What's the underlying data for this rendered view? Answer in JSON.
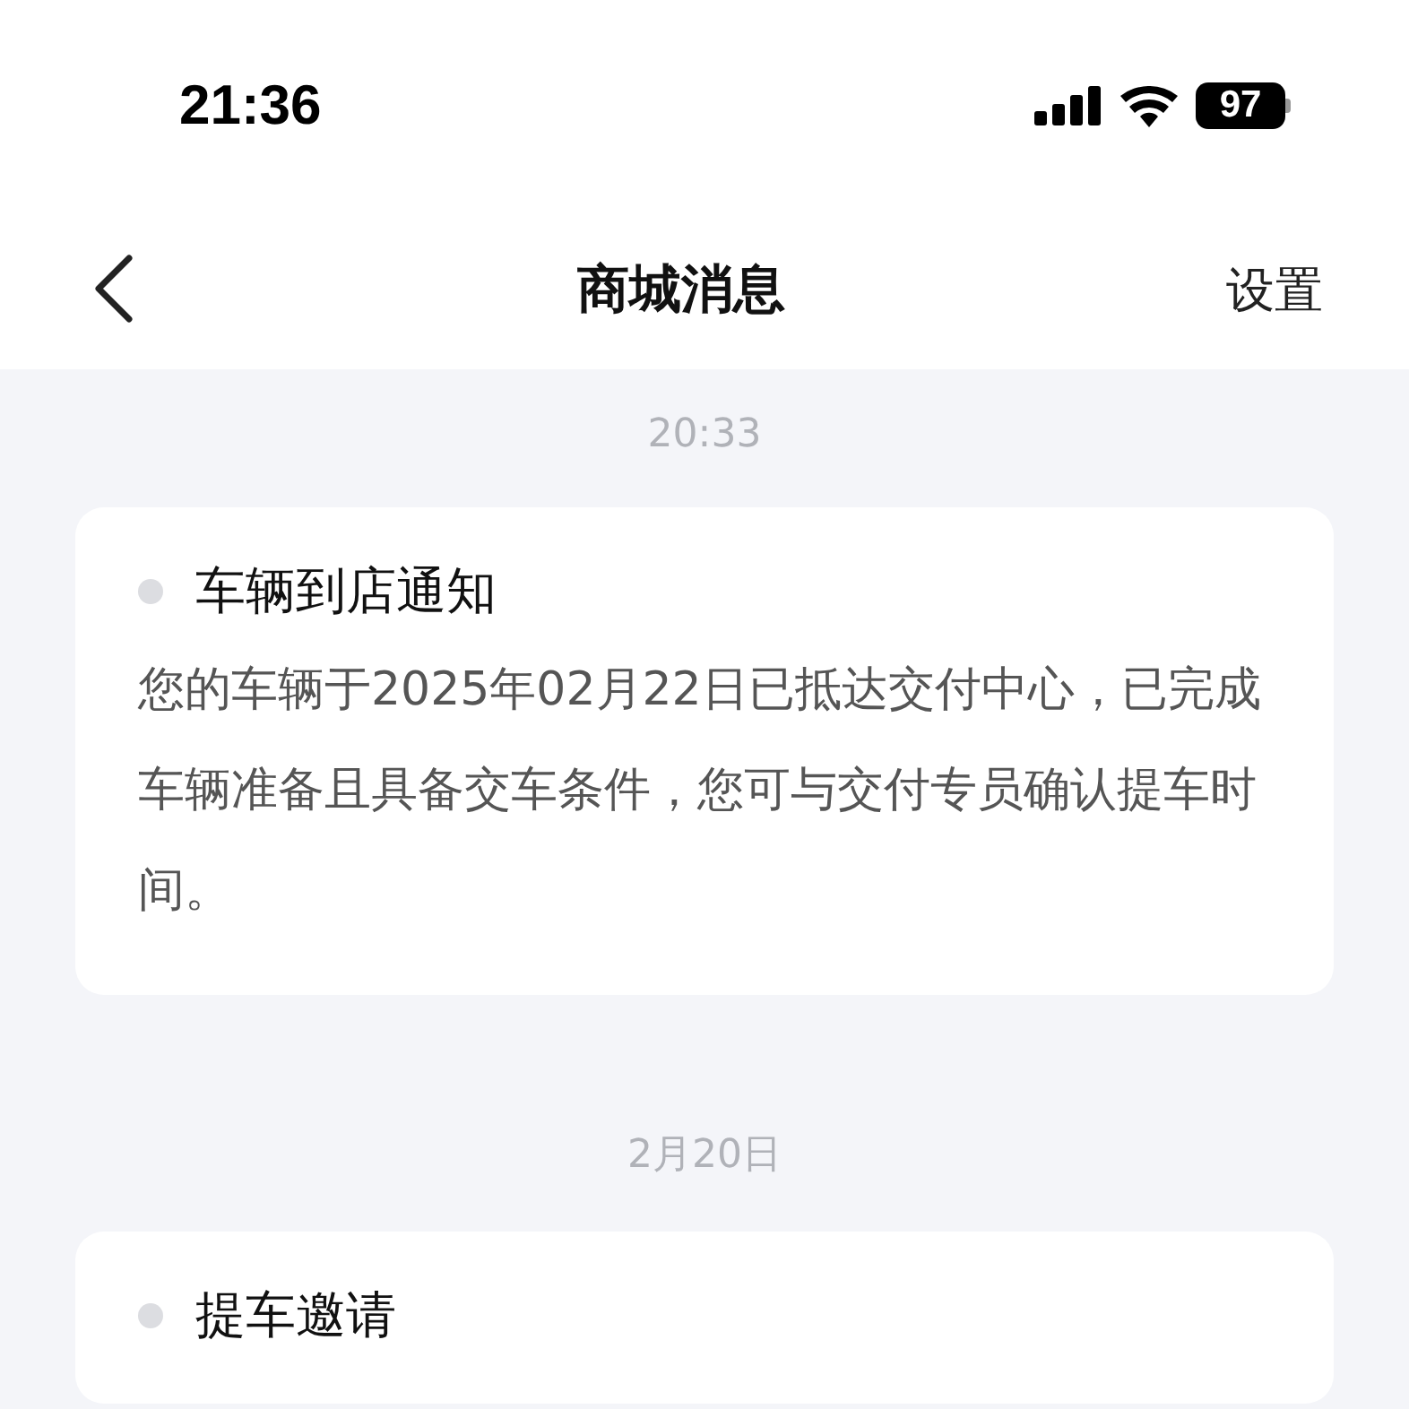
{
  "status_bar": {
    "time": "21:36",
    "battery": "97"
  },
  "nav": {
    "title": "商城消息",
    "action": "设置"
  },
  "messages": [
    {
      "time": "20:33",
      "title": "车辆到店通知",
      "body": "您的车辆于2025年02月22日已抵达交付中心，已完成车辆准备且具备交车条件，您可与交付专员确认提车时间。"
    },
    {
      "time": "2月20日",
      "title": "提车邀请"
    }
  ]
}
